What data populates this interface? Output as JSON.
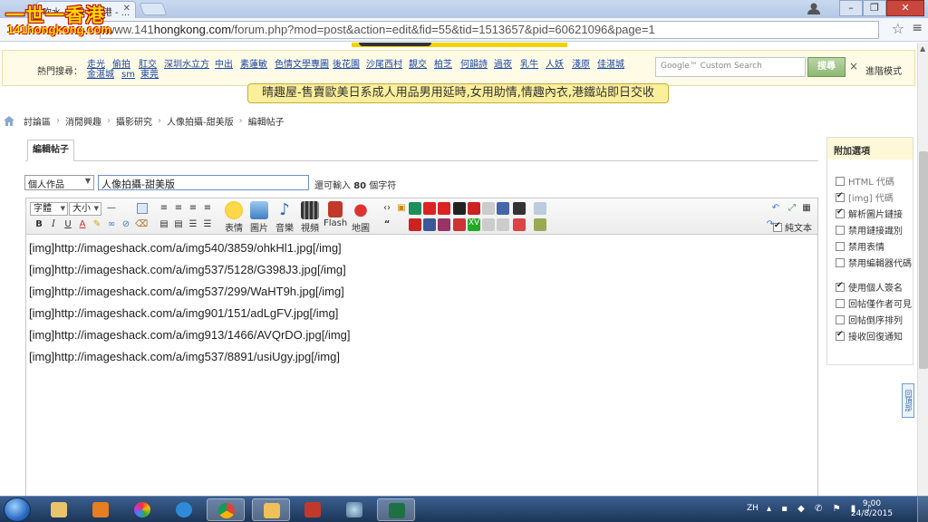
{
  "browser": {
    "tab_title": "吹水 -一世一香港 - ...",
    "url_prefix": "www.141",
    "url_host": "hongkong.com",
    "url_path": "/forum.php?mod=post&action=edit&fid=55&tid=1513657&pid=60621096&page=1"
  },
  "logo": {
    "line1": "一世一香港",
    "line2": "141hongkong.com"
  },
  "hotbar": {
    "label": "熱門搜尋：",
    "links": [
      {
        "text": "走光"
      },
      {
        "text": "偷拍"
      },
      {
        "text": "肛交"
      },
      {
        "text": "深圳水立方"
      },
      {
        "text": "中出"
      },
      {
        "text": "素蓮敏"
      },
      {
        "text": "色情文學專圖"
      },
      {
        "text": "後花園"
      },
      {
        "text": "沙尾西村"
      },
      {
        "text": "靚交"
      },
      {
        "text": "柏芝"
      },
      {
        "text": "何韻詩"
      },
      {
        "text": "過夜"
      },
      {
        "text": "乳牛"
      },
      {
        "text": "人妖"
      },
      {
        "text": "淺原"
      },
      {
        "text": "佳湛城"
      },
      {
        "text": "金湛城"
      },
      {
        "text": "sm"
      },
      {
        "text": "東莞"
      }
    ],
    "search_placeholder": "Google™ Custom Search",
    "search_button": "搜尋",
    "close": "×",
    "advanced": "進階模式"
  },
  "ad_banner": "晴趣屋-售賣歐美日系成人用品男用延時,女用助情,情趣內衣,港鐵站即日交收",
  "breadcrumb": [
    "討論區",
    "消閒興趣",
    "攝影研究",
    "人像拍攝-甜美版",
    "編輯帖子"
  ],
  "editor": {
    "tab_label": "編輯帖子",
    "category": "個人作品",
    "title": "人像拍攝-甜美版",
    "hint_prefix": "還可輸入",
    "hint_count": "80",
    "hint_suffix": "個字符",
    "font_select": "字體",
    "size_select": "大小",
    "buttons": {
      "emoji": "表情",
      "image": "圖片",
      "music": "音樂",
      "video": "視頻",
      "flash": "Flash",
      "map": "地圖"
    },
    "plain_text_label": "純文本",
    "content_lines": [
      "[img]http://imageshack.com/a/img540/3859/ohkHl1.jpg[/img]",
      "[img]http://imageshack.com/a/img537/5128/G398J3.jpg[/img]",
      "[img]http://imageshack.com/a/img537/299/WaHT9h.jpg[/img]",
      "[img]http://imageshack.com/a/img901/151/adLgFV.jpg[/img]",
      "[img]http://imageshack.com/a/img913/1466/AVQrDO.jpg[/img]",
      "[img]http://imageshack.com/a/img537/8891/usiUgy.jpg[/img]"
    ]
  },
  "side_options": {
    "title": "附加選項",
    "items": [
      {
        "label": "HTML 代碼",
        "checked": false,
        "dim": true
      },
      {
        "label": "[img] 代碼",
        "checked": true,
        "dim": true
      },
      {
        "label": "解析圖片鏈接",
        "checked": true,
        "dim": false
      },
      {
        "label": "禁用鏈接識別",
        "checked": false,
        "dim": false
      },
      {
        "label": "禁用表情",
        "checked": false,
        "dim": false
      },
      {
        "label": "禁用編輯器代碼",
        "checked": false,
        "dim": false
      },
      {
        "label": "使用個人簽名",
        "checked": true,
        "dim": false
      },
      {
        "label": "回帖僅作者可見",
        "checked": false,
        "dim": false
      },
      {
        "label": "回帖倒序排列",
        "checked": false,
        "dim": false
      },
      {
        "label": "接收回復通知",
        "checked": true,
        "dim": false
      }
    ]
  },
  "back_to_top": "回頂部",
  "taskbar": {
    "lang": "ZH",
    "time": "9:00",
    "date": "24/8/2015"
  }
}
